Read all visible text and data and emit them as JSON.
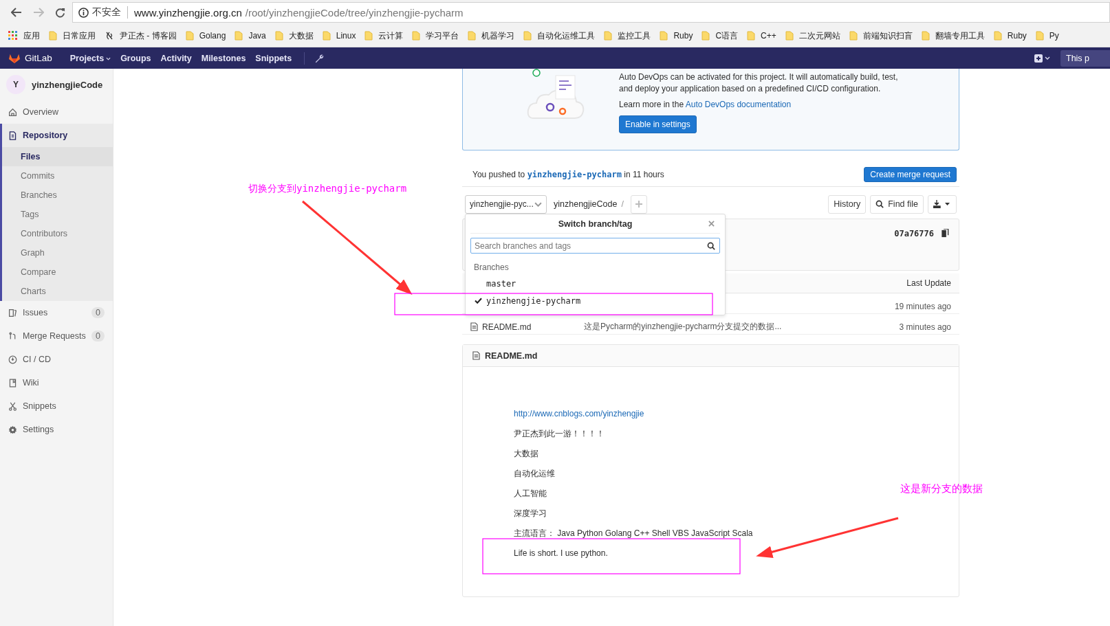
{
  "browser": {
    "security": "不安全",
    "host": "www.yinzhengjie.org.cn",
    "path": "/root/yinzhengjieCode/tree/yinzhengjie-pycharm"
  },
  "bookmarks": [
    {
      "label": "应用",
      "kind": "apps"
    },
    {
      "label": "日常应用",
      "kind": "folder"
    },
    {
      "label": "尹正杰 - 博客园",
      "kind": "site"
    },
    {
      "label": "Golang",
      "kind": "folder"
    },
    {
      "label": "Java",
      "kind": "folder"
    },
    {
      "label": "大数据",
      "kind": "folder"
    },
    {
      "label": "Linux",
      "kind": "folder"
    },
    {
      "label": "云计算",
      "kind": "folder"
    },
    {
      "label": "学习平台",
      "kind": "folder"
    },
    {
      "label": "机器学习",
      "kind": "folder"
    },
    {
      "label": "自动化运维工具",
      "kind": "folder"
    },
    {
      "label": "监控工具",
      "kind": "folder"
    },
    {
      "label": "Ruby",
      "kind": "folder"
    },
    {
      "label": "C语言",
      "kind": "folder"
    },
    {
      "label": "C++",
      "kind": "folder"
    },
    {
      "label": "二次元网站",
      "kind": "folder"
    },
    {
      "label": "前端知识扫盲",
      "kind": "folder"
    },
    {
      "label": "翻墙专用工具",
      "kind": "folder"
    },
    {
      "label": "Ruby",
      "kind": "folder"
    },
    {
      "label": "Py",
      "kind": "folder"
    }
  ],
  "nav": {
    "brand": "GitLab",
    "items": [
      {
        "label": "Projects",
        "dropdown": true
      },
      {
        "label": "Groups",
        "dropdown": false
      },
      {
        "label": "Activity",
        "dropdown": false
      },
      {
        "label": "Milestones",
        "dropdown": false
      },
      {
        "label": "Snippets",
        "dropdown": false
      }
    ],
    "right_label": "This p"
  },
  "sidebar": {
    "initial": "Y",
    "project": "yinzhengjieCode",
    "items": [
      {
        "label": "Overview",
        "selected": false
      },
      {
        "label": "Repository",
        "selected": true,
        "children": [
          {
            "label": "Files",
            "selected": true
          },
          {
            "label": "Commits",
            "selected": false
          },
          {
            "label": "Branches",
            "selected": false
          },
          {
            "label": "Tags",
            "selected": false
          },
          {
            "label": "Contributors",
            "selected": false
          },
          {
            "label": "Graph",
            "selected": false
          },
          {
            "label": "Compare",
            "selected": false
          },
          {
            "label": "Charts",
            "selected": false
          }
        ]
      },
      {
        "label": "Issues",
        "selected": false,
        "count": "0"
      },
      {
        "label": "Merge Requests",
        "selected": false,
        "count": "0"
      },
      {
        "label": "CI / CD",
        "selected": false
      },
      {
        "label": "Wiki",
        "selected": false
      },
      {
        "label": "Snippets",
        "selected": false
      },
      {
        "label": "Settings",
        "selected": false
      }
    ]
  },
  "banner": {
    "line_1": "Auto DevOps can be activated for this project. It will automatically build, test,",
    "line_2": "and deploy your application based on a predefined CI/CD configuration.",
    "learn_prefix": "Learn more in the",
    "link": "Auto DevOps documentation",
    "button": "Enable in settings"
  },
  "push": {
    "prefix": "You pushed to",
    "branch": "yinzhengjie-pycharm",
    "suffix": "in 11 hours",
    "button": "Create merge request"
  },
  "toolbar": {
    "branch_select": "yinzhengjie-pyc...",
    "path": "yinzhengjieCode",
    "separator": "/",
    "history": "History",
    "find_file": "Find file"
  },
  "commit": {
    "sha": "07a76776"
  },
  "dropdown": {
    "title": "Switch branch/tag",
    "search_placeholder": "Search branches and tags",
    "section": "Branches",
    "branches": [
      {
        "name": "master",
        "selected": false
      },
      {
        "name": "yinzhengjie-pycharm",
        "selected": true
      }
    ]
  },
  "files": {
    "last_update": "Last Update",
    "rows": [
      {
        "time": "19 minutes ago"
      },
      {
        "name": "README.md",
        "message": "这是Pycharm的yinzhengjie-pycharm分支提交的数据...",
        "time": "3 minutes ago"
      }
    ]
  },
  "readme": {
    "title": "README.md",
    "link": "http://www.cnblogs.com/yinzhengjie",
    "lines": [
      "尹正杰到此一游！！！！",
      "大数据",
      "自动化运维",
      "人工智能",
      "深度学习",
      "主流语言： Java Python Golang C++ Shell VBS JavaScript Scala",
      "Life is short. I use python."
    ]
  },
  "annotations": [
    {
      "text": "切换分支到yinzhengjie-pycharm"
    },
    {
      "text": "这是新分支的数据"
    }
  ]
}
